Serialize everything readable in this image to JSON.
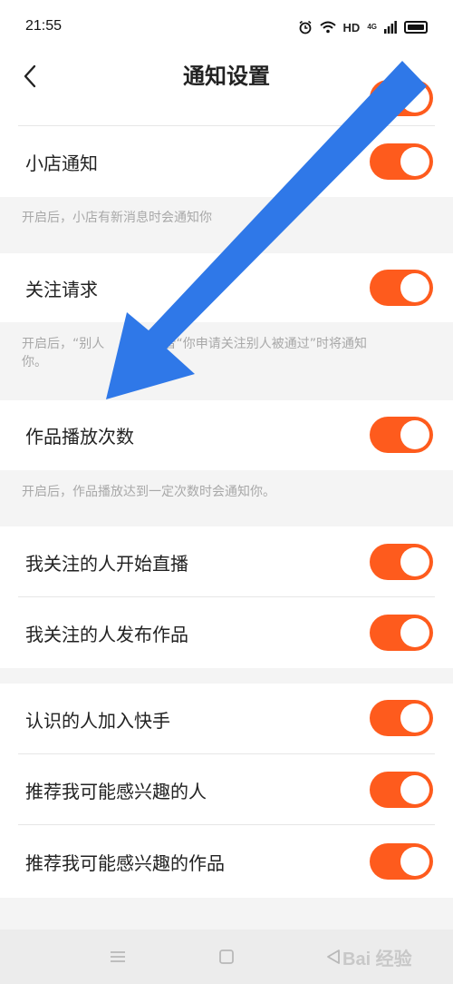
{
  "status_bar": {
    "time": "21:55",
    "hd": "HD",
    "network": "4G"
  },
  "header": {
    "title": "通知设置"
  },
  "rows": [
    {
      "label": "小店通知",
      "enabled": true
    },
    {
      "label": "关注请求",
      "enabled": true
    },
    {
      "label": "作品播放次数",
      "enabled": true
    },
    {
      "label": "我关注的人开始直播",
      "enabled": true
    },
    {
      "label": "我关注的人发布作品",
      "enabled": true
    },
    {
      "label": "认识的人加入快手",
      "enabled": true
    },
    {
      "label": "推荐我可能感兴趣的人",
      "enabled": true
    },
    {
      "label": "推荐我可能感兴趣的作品",
      "enabled": true
    }
  ],
  "notes": {
    "shop": "开启后，小店有新消息时会通知你",
    "follow_line1": "开启后，“别人",
    "follow_line1_end": "你”或者“你申请关注别人被通过”时将通知",
    "follow_line2": "你。",
    "play": "开启后，作品播放达到一定次数时会通知你。"
  },
  "watermark": "Bai 经验",
  "colors": {
    "accent": "#fe5b1d",
    "arrow": "#2f78e8"
  }
}
